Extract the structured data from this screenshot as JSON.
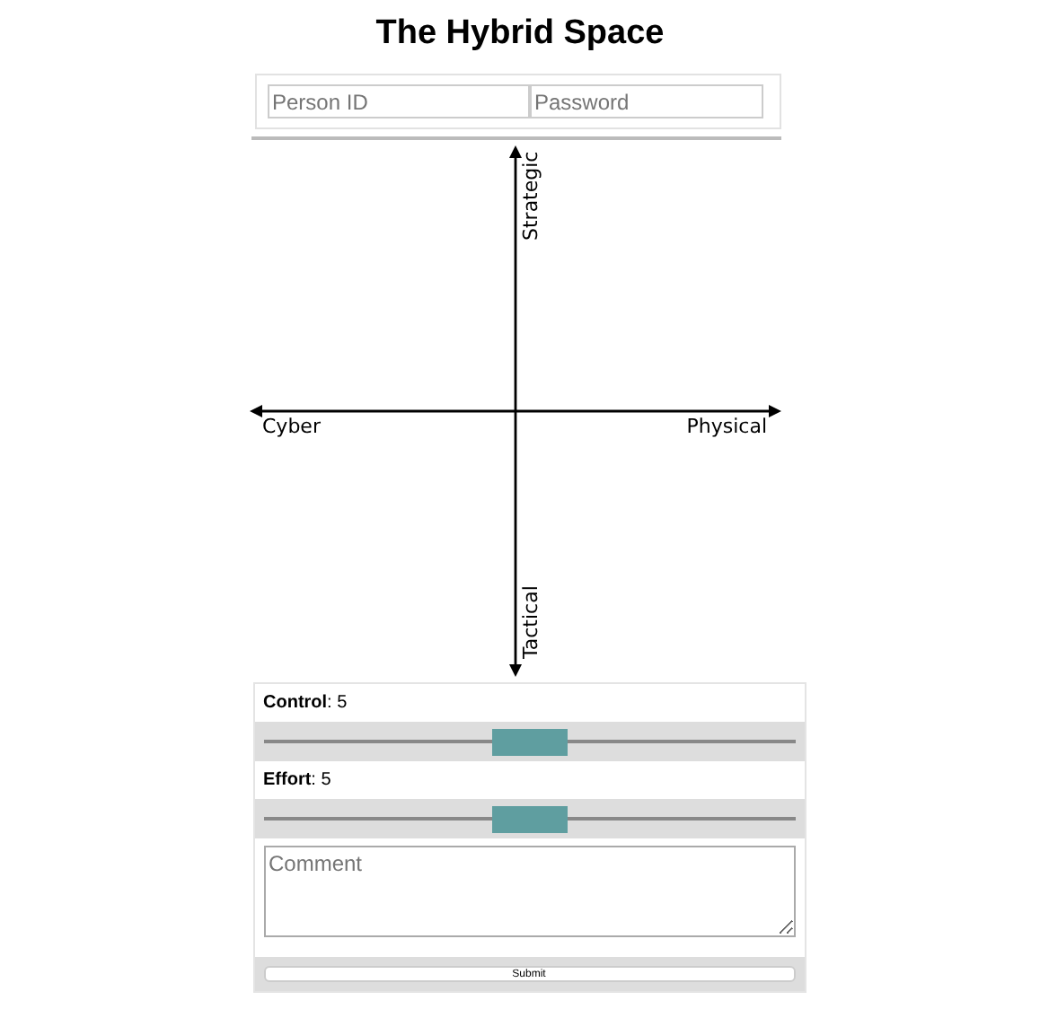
{
  "title": "The Hybrid Space",
  "login": {
    "person_id": {
      "placeholder": "Person ID"
    },
    "password": {
      "placeholder": "Password"
    }
  },
  "quadrant": {
    "top": "Strategic",
    "bottom": "Tactical",
    "left": "Cyber",
    "right": "Physical"
  },
  "sliders": [
    {
      "label": "**Control**: 5",
      "level": 0.5
    },
    {
      "label": "**Effort**: 5",
      "level": 0.5
    }
  ],
  "comment": {
    "placeholder": "Comment"
  },
  "submit": "Submit"
}
